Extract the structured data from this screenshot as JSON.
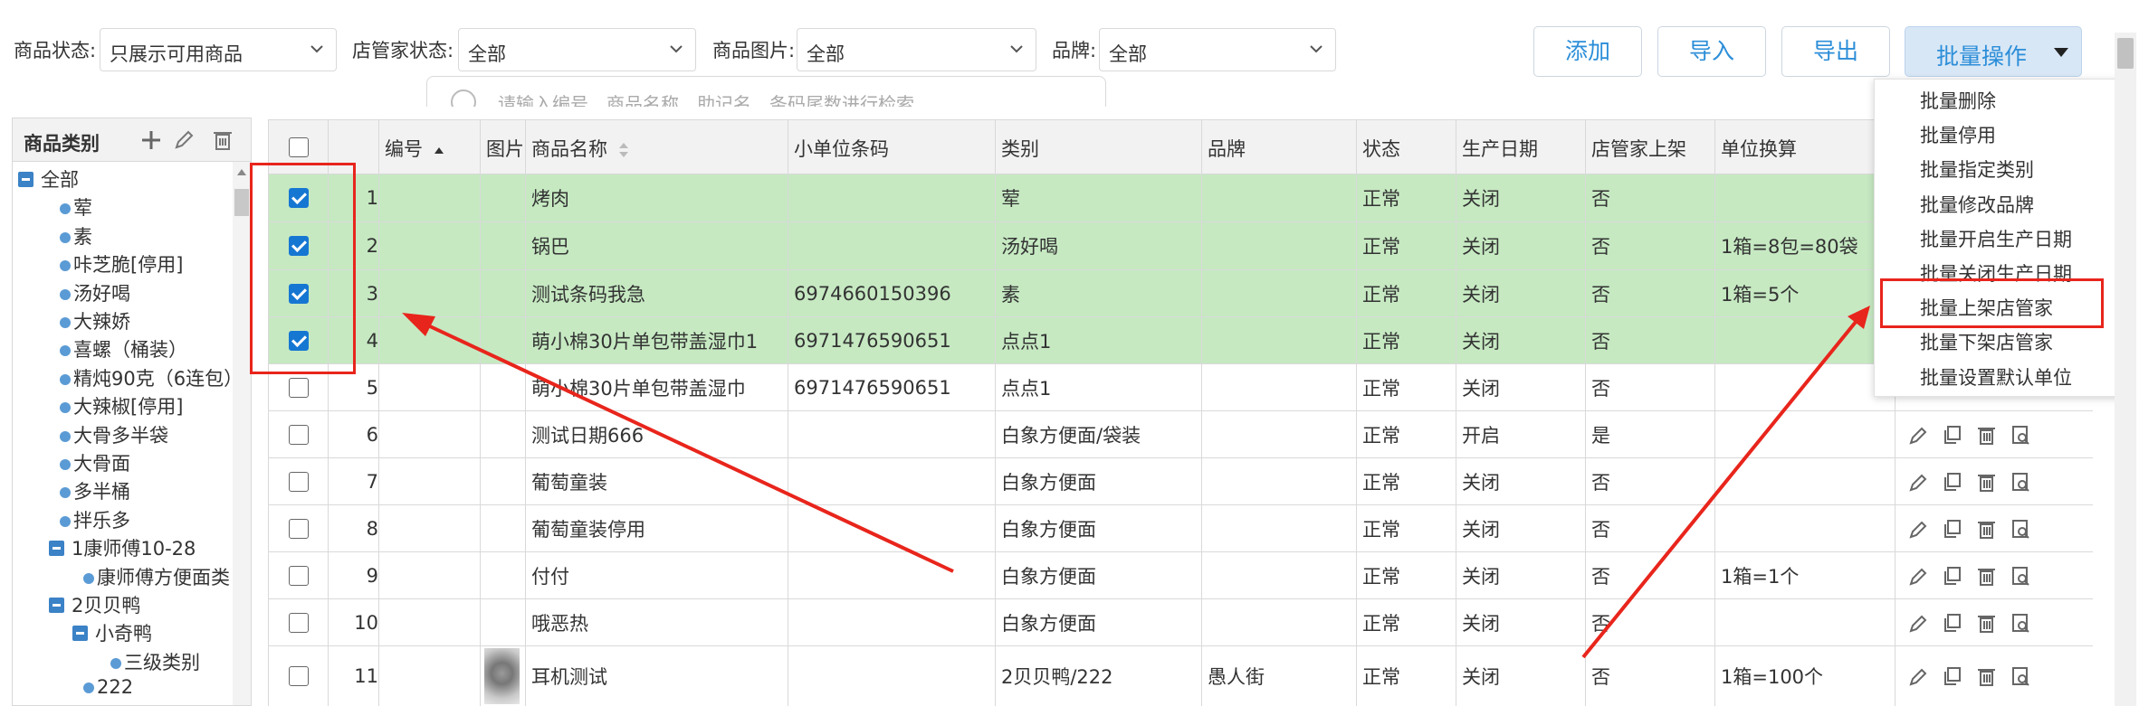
{
  "filters": {
    "product_status": {
      "label": "商品状态:",
      "value": "只展示可用商品"
    },
    "keeper_status": {
      "label": "店管家状态:",
      "value": "全部"
    },
    "product_image": {
      "label": "商品图片:",
      "value": "全部"
    },
    "brand": {
      "label": "品牌:",
      "value": "全部"
    },
    "search_placeholder": "请输入编号、商品名称、助记名、条码尾数进行检索"
  },
  "toolbar": {
    "add": "添加",
    "import": "导入",
    "export": "导出",
    "batch": "批量操作"
  },
  "batch_menu": [
    "批量删除",
    "批量停用",
    "批量指定类别",
    "批量修改品牌",
    "批量开启生产日期",
    "批量关闭生产日期",
    "批量上架店管家",
    "批量下架店管家",
    "批量设置默认单位"
  ],
  "sidebar": {
    "title": "商品类别",
    "tree": [
      {
        "label": "全部",
        "type": "folder",
        "level": 0
      },
      {
        "label": "荤",
        "type": "leaf",
        "level": 1
      },
      {
        "label": "素",
        "type": "leaf",
        "level": 1
      },
      {
        "label": "咔芝脆[停用]",
        "type": "leaf",
        "level": 1
      },
      {
        "label": "汤好喝",
        "type": "leaf",
        "level": 1
      },
      {
        "label": "大辣娇",
        "type": "leaf",
        "level": 1
      },
      {
        "label": "喜螺（桶装）",
        "type": "leaf",
        "level": 1
      },
      {
        "label": "精炖90克（6连包）",
        "type": "leaf",
        "level": 1
      },
      {
        "label": "大辣椒[停用]",
        "type": "leaf",
        "level": 1
      },
      {
        "label": "大骨多半袋",
        "type": "leaf",
        "level": 1
      },
      {
        "label": "大骨面",
        "type": "leaf",
        "level": 1
      },
      {
        "label": "多半桶",
        "type": "leaf",
        "level": 1
      },
      {
        "label": "拌乐多",
        "type": "leaf",
        "level": 1
      },
      {
        "label": "1康师傅10-28",
        "type": "folder",
        "level": 1
      },
      {
        "label": "康师傅方便面类",
        "type": "leaf",
        "level": 2
      },
      {
        "label": "2贝贝鸭",
        "type": "folder",
        "level": 1
      },
      {
        "label": "小奇鸭",
        "type": "folder",
        "level": 2
      },
      {
        "label": "三级类别",
        "type": "leaf",
        "level": 3
      },
      {
        "label": "222",
        "type": "leaf",
        "level": 2
      }
    ]
  },
  "table": {
    "headers": [
      "编号",
      "图片",
      "商品名称",
      "小单位条码",
      "类别",
      "品牌",
      "状态",
      "生产日期",
      "店管家上架",
      "单位换算"
    ],
    "rows": [
      {
        "no": "1",
        "name": "烤肉",
        "barcode": "",
        "category": "荤",
        "brand": "",
        "status": "正常",
        "prod_date": "关闭",
        "keeper": "否",
        "unit": "",
        "checked": true,
        "img": false
      },
      {
        "no": "2",
        "name": "锅巴",
        "barcode": "",
        "category": "汤好喝",
        "brand": "",
        "status": "正常",
        "prod_date": "关闭",
        "keeper": "否",
        "unit": "1箱=8包=80袋",
        "checked": true,
        "img": false
      },
      {
        "no": "3",
        "name": "测试条码我急",
        "barcode": "6974660150396",
        "category": "素",
        "brand": "",
        "status": "正常",
        "prod_date": "关闭",
        "keeper": "否",
        "unit": "1箱=5个",
        "checked": true,
        "img": false
      },
      {
        "no": "4",
        "name": "萌小棉30片单包带盖湿巾1",
        "barcode": "6971476590651",
        "category": "点点1",
        "brand": "",
        "status": "正常",
        "prod_date": "关闭",
        "keeper": "否",
        "unit": "",
        "checked": true,
        "img": false
      },
      {
        "no": "5",
        "name": "萌小棉30片单包带盖湿巾",
        "barcode": "6971476590651",
        "category": "点点1",
        "brand": "",
        "status": "正常",
        "prod_date": "关闭",
        "keeper": "否",
        "unit": "",
        "checked": false,
        "img": false
      },
      {
        "no": "6",
        "name": "测试日期666",
        "barcode": "",
        "category": "白象方便面/袋装",
        "brand": "",
        "status": "正常",
        "prod_date": "开启",
        "keeper": "是",
        "unit": "",
        "checked": false,
        "img": false
      },
      {
        "no": "7",
        "name": "葡萄童装",
        "barcode": "",
        "category": "白象方便面",
        "brand": "",
        "status": "正常",
        "prod_date": "关闭",
        "keeper": "否",
        "unit": "",
        "checked": false,
        "img": false
      },
      {
        "no": "8",
        "name": "葡萄童装停用",
        "barcode": "",
        "category": "白象方便面",
        "brand": "",
        "status": "正常",
        "prod_date": "关闭",
        "keeper": "否",
        "unit": "",
        "checked": false,
        "img": false
      },
      {
        "no": "9",
        "name": "付付",
        "barcode": "",
        "category": "白象方便面",
        "brand": "",
        "status": "正常",
        "prod_date": "关闭",
        "keeper": "否",
        "unit": "1箱=1个",
        "checked": false,
        "img": false
      },
      {
        "no": "10",
        "name": "哦恶热",
        "barcode": "",
        "category": "白象方便面",
        "brand": "",
        "status": "正常",
        "prod_date": "关闭",
        "keeper": "否",
        "unit": "",
        "checked": false,
        "img": false
      },
      {
        "no": "11",
        "name": "耳机测试",
        "barcode": "",
        "category": "2贝贝鸭/222",
        "brand": "愚人街",
        "status": "正常",
        "prod_date": "关闭",
        "keeper": "否",
        "unit": "1箱=100个",
        "checked": false,
        "img": true
      }
    ]
  },
  "colors": {
    "accent": "#2c8ed8",
    "selected_row": "#c6e9c2",
    "annotation_red": "#e8251c"
  }
}
